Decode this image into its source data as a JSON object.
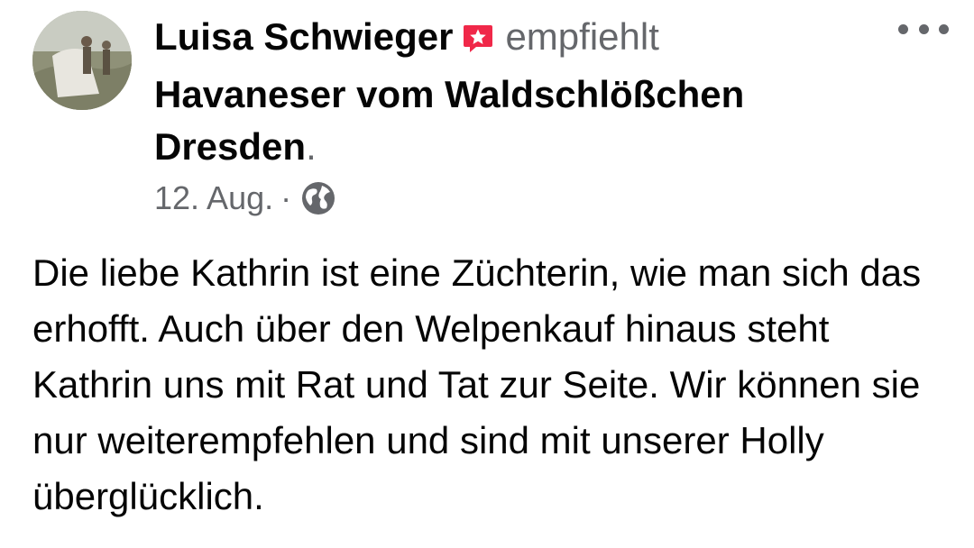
{
  "post": {
    "author_name": "Luisa Schwieger",
    "action": "empfiehlt",
    "page_name": "Havaneser vom Waldschlößchen Dresden",
    "period": ".",
    "date": "12. Aug.",
    "separator": "·",
    "privacy_icon": "globe-icon",
    "more_icon": "more-options-icon",
    "recommendation_icon": "recommendation-star-icon",
    "body": "Die liebe Kathrin ist eine Züchterin, wie man sich das erhofft. Auch über den Welpenkauf hinaus steht Kathrin uns mit Rat und Tat zur Seite. Wir können sie nur weiterempfehlen und sind mit unserer Holly überglücklich."
  },
  "colors": {
    "text_primary": "#050505",
    "text_secondary": "#65676b",
    "recommend_accent": "#f02849"
  }
}
